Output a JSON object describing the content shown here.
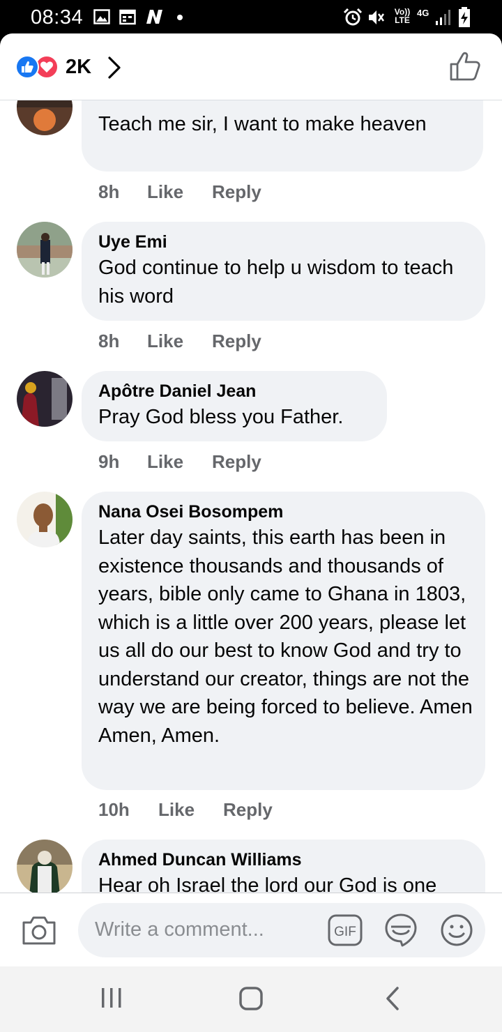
{
  "status_bar": {
    "time": "08:34",
    "network_label": "Vo)) LTE",
    "network_type": "4G",
    "icons": [
      "gallery-icon",
      "calendar-icon",
      "n-app-icon",
      "dot-icon",
      "alarm-icon",
      "mute-icon",
      "signal-icon",
      "battery-charging-icon"
    ]
  },
  "header": {
    "reaction_count": "2K",
    "reactions": [
      "like-reaction-icon",
      "love-reaction-icon"
    ],
    "colors": {
      "like": "#1877f2",
      "love": "#f33e58"
    }
  },
  "comments": [
    {
      "name": "",
      "text": "Teach me sir, I want to make heaven",
      "time": "8h",
      "like_label": "Like",
      "reply_label": "Reply"
    },
    {
      "name": "Uye Emi",
      "text": "God continue to help u wisdom to teach his word",
      "time": "8h",
      "like_label": "Like",
      "reply_label": "Reply"
    },
    {
      "name": "Apôtre Daniel Jean",
      "text": "Pray God bless you Father.",
      "time": "9h",
      "like_label": "Like",
      "reply_label": "Reply"
    },
    {
      "name": "Nana Osei Bosompem",
      "text": "Later day saints, this earth has been in existence thousands and thousands of years, bible only came to Ghana in 1803, which is a little over 200 years, please let us all do our best to know God and try to understand our creator, things are not the way we are being forced to believe. Amen Amen, Amen.",
      "time": "10h",
      "like_label": "Like",
      "reply_label": "Reply"
    },
    {
      "name": "Ahmed Duncan Williams",
      "text": "Hear oh Israel the lord our God is one God, and worshiping any thing other",
      "time": "",
      "like_label": "",
      "reply_label": ""
    }
  ],
  "composer": {
    "placeholder": "Write a comment...",
    "gif_label": "GIF",
    "icons": [
      "camera-icon",
      "gif-icon",
      "sticker-icon",
      "emoji-icon"
    ]
  },
  "nav_bar": {
    "icons": [
      "recent-apps-icon",
      "home-icon",
      "back-icon"
    ]
  }
}
